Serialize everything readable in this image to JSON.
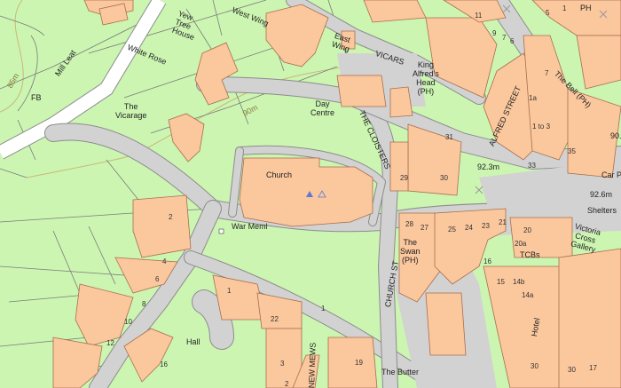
{
  "map": {
    "colors": {
      "background": "#ccf5b2",
      "building": "#fbc79d",
      "building_outline": "#a86e4d",
      "road": "#d2d2d2",
      "road_edge": "#8c8c8c",
      "contour": "#c9b878",
      "boundary": "#7a7a7a",
      "white_road": "#ffffff"
    },
    "labels": {
      "yew_tree_house": "Yew\nTree\nHouse",
      "west_wing": "West Wing",
      "east_wing": "East\nWing",
      "white_rose": "White Rose",
      "mill_leat": "Mill Leat",
      "fb": "FB",
      "contour_85m": "85m",
      "contour_90m": "90m",
      "the_vicarage": "The\nVicarage",
      "day_centre": "Day\nCentre",
      "the_cloisters": "THE CLOISTERS",
      "church": "Church",
      "war_meml": "War Meml",
      "vicars": "VICARS",
      "king_alfreds_head": "King\nAlfred's\nHead\n(PH)",
      "alfred_street": "ALFRED STREET",
      "the_bell": "The Bell (PH)",
      "spot_923": "92.3m",
      "spot_926": "92.6m",
      "car_p": "Car P",
      "spot_90": "90.",
      "shelters": "Shelters",
      "the_swan": "The\nSwan\n(PH)",
      "church_st": "CHURCH ST",
      "victoria_cross_gallery": "Victoria\nCross\nGallery",
      "tcbs": "TCBs",
      "hotel": "Hotel",
      "hall": "Hall",
      "the_butter": "The Butter",
      "new_mews": "NEW MEWS",
      "ph": "PH"
    },
    "numbers": [
      "11",
      "9",
      "7",
      "6",
      "5",
      "1",
      "7",
      "1a",
      "1 to 3",
      "35",
      "33",
      "31",
      "29",
      "30",
      "28",
      "27",
      "25",
      "24",
      "23",
      "21",
      "20",
      "20a",
      "16",
      "15",
      "14b",
      "14a",
      "30",
      "2",
      "4",
      "6",
      "8",
      "10",
      "12",
      "16",
      "1",
      "22",
      "19",
      "3",
      "2",
      "1",
      "17",
      "30"
    ]
  }
}
